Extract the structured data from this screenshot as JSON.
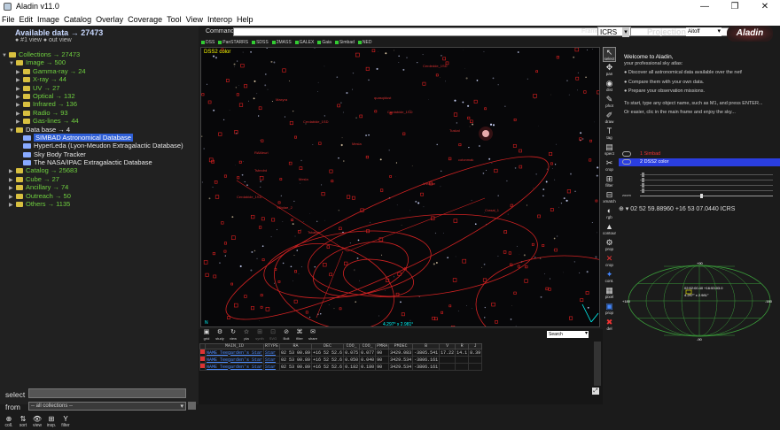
{
  "window": {
    "title": "Aladin v11.0",
    "min": "—",
    "max": "❐",
    "close": "✕"
  },
  "menu": [
    "File",
    "Edit",
    "Image",
    "Catalog",
    "Overlay",
    "Coverage",
    "Tool",
    "View",
    "Interop",
    "Help"
  ],
  "left": {
    "available": "Available data → 27473",
    "view_line": "● #1 view ● out view",
    "tree": [
      {
        "indent": 0,
        "arrow": "▼",
        "type": "folder",
        "label": "Collections → 27473",
        "cls": "green"
      },
      {
        "indent": 1,
        "arrow": "▼",
        "type": "folder",
        "label": "Image → 500",
        "cls": "green"
      },
      {
        "indent": 2,
        "arrow": "▶",
        "type": "folder",
        "label": "Gamma-ray → 24",
        "cls": "green"
      },
      {
        "indent": 2,
        "arrow": "▶",
        "type": "folder",
        "label": "X-ray → 44",
        "cls": "green"
      },
      {
        "indent": 2,
        "arrow": "▶",
        "type": "folder",
        "label": "UV → 27",
        "cls": "green"
      },
      {
        "indent": 2,
        "arrow": "▶",
        "type": "folder",
        "label": "Optical → 132",
        "cls": "green"
      },
      {
        "indent": 2,
        "arrow": "▶",
        "type": "folder",
        "label": "Infrared → 136",
        "cls": "green"
      },
      {
        "indent": 2,
        "arrow": "▶",
        "type": "folder",
        "label": "Radio → 93",
        "cls": "green"
      },
      {
        "indent": 2,
        "arrow": "▶",
        "type": "folder",
        "label": "Gas-lines → 44",
        "cls": "green"
      },
      {
        "indent": 1,
        "arrow": "▼",
        "type": "folder",
        "label": "Data base → 4",
        "cls": "white"
      },
      {
        "indent": 2,
        "arrow": "",
        "type": "item",
        "label": "SIMBAD Astronomical Database",
        "cls": "sel"
      },
      {
        "indent": 2,
        "arrow": "",
        "type": "item",
        "label": "HyperLeda (Lyon-Meudon Extragalactic Database)",
        "cls": "white"
      },
      {
        "indent": 2,
        "arrow": "",
        "type": "item",
        "label": "Sky Body Tracker",
        "cls": "white"
      },
      {
        "indent": 2,
        "arrow": "",
        "type": "item",
        "label": "The NASA/IPAC Extragalactic Database",
        "cls": "white"
      },
      {
        "indent": 1,
        "arrow": "▶",
        "type": "folder",
        "label": "Catalog → 25683",
        "cls": "green"
      },
      {
        "indent": 1,
        "arrow": "▶",
        "type": "folder",
        "label": "Cube → 27",
        "cls": "green"
      },
      {
        "indent": 1,
        "arrow": "▶",
        "type": "folder",
        "label": "Ancillary → 74",
        "cls": "green"
      },
      {
        "indent": 1,
        "arrow": "▶",
        "type": "folder",
        "label": "Outreach → 50",
        "cls": "green"
      },
      {
        "indent": 1,
        "arrow": "▶",
        "type": "folder",
        "label": "Others → 1135",
        "cls": "green"
      }
    ],
    "select_label": "select",
    "from_label": "from",
    "from_value": "-- all collections --",
    "tools": [
      {
        "icon": "⊕",
        "label": "coll."
      },
      {
        "icon": "⇅",
        "label": "sort"
      },
      {
        "icon": "👁",
        "label": "view"
      },
      {
        "icon": "⊞",
        "label": "insp."
      },
      {
        "icon": "Y",
        "label": "filter"
      }
    ]
  },
  "command": {
    "label": "Command",
    "clear": "✕ ▾"
  },
  "frame": {
    "label": "Frame",
    "value": "ICRS"
  },
  "projection": {
    "label": "Projection",
    "value": "Aitoff"
  },
  "logo": "Aladin",
  "surveys": [
    "DSS",
    "PanSTARRS",
    "SDSS",
    "2MASS",
    "GALEX",
    "Gaia",
    "Simbad",
    "NED"
  ],
  "sky": {
    "survey_label": "DSS2 color",
    "coord_text": "4.297° x 2.981°",
    "fov_text": "N",
    "labels": [
      "Cerdedde_1SD",
      "Maxyra",
      "quasqidust",
      "Cerdabide_1SD",
      "Tuskal",
      "Cerdabide_1SD",
      "Tsbndrd",
      "RAMeuri",
      "cotonmak",
      "Mesla",
      "Crasal_1",
      "Cerdabide_1SD",
      "Yllbdae_2",
      "Mesla",
      "Vredrue",
      "Tskalna"
    ]
  },
  "toolbar": [
    {
      "icon": "↖",
      "label": "select",
      "cls": "active"
    },
    {
      "icon": "✥",
      "label": "pan",
      "cls": ""
    },
    {
      "icon": "◉",
      "label": "dist",
      "cls": ""
    },
    {
      "icon": "✎",
      "label": "phot",
      "cls": ""
    },
    {
      "icon": "✐",
      "label": "draw",
      "cls": ""
    },
    {
      "icon": "T",
      "label": "tag",
      "cls": ""
    },
    {
      "icon": "▤",
      "label": "spect",
      "cls": ""
    },
    {
      "icon": "✂",
      "label": "crop",
      "cls": ""
    },
    {
      "icon": "⊞",
      "label": "filter",
      "cls": ""
    },
    {
      "icon": "⊟",
      "label": "xmatch",
      "cls": ""
    },
    {
      "icon": "◐",
      "label": "rgb",
      "cls": ""
    },
    {
      "icon": "▲",
      "label": "contour",
      "cls": ""
    },
    {
      "icon": "⚙",
      "label": "prop",
      "cls": ""
    },
    {
      "icon": "✕",
      "label": "crop",
      "cls": "red"
    },
    {
      "icon": "✦",
      "label": "cont.",
      "cls": "blue"
    },
    {
      "icon": "▦",
      "label": "pixel",
      "cls": ""
    },
    {
      "icon": "▣",
      "label": "prop",
      "cls": "blue"
    },
    {
      "icon": "✖",
      "label": "del",
      "cls": "red"
    }
  ],
  "welcome": {
    "title": "Welcome to Aladin,",
    "subtitle": "your professional sky atlas:",
    "bullets": [
      "Discover all astronomical data available over the net!",
      "Compare them with your own data.",
      "Prepare your observation missions."
    ],
    "hint1": "To start, type any object name, such as M1, and press ENTER...",
    "hint2": "Or easier, clic in the main frame and enjoy the sky..."
  },
  "stack": {
    "layers": [
      {
        "num": "1",
        "name": "Simbad",
        "cls": ""
      },
      {
        "num": "2",
        "name": "DSS2 color",
        "cls": "sel"
      }
    ],
    "zoom_label": "zoom"
  },
  "target_line": "⊕ ▾ 02 52 59.88960 +16 53 07.0440 ICRS",
  "allsky": {
    "center_text": "02:52:00.40 +16:53:03.0",
    "fov": "4.297° x 2.981°",
    "lat_top": "+90",
    "lat_bottom": "-90",
    "lon_left": "+180",
    "lon_right": "-180"
  },
  "table": {
    "tools": [
      {
        "icon": "▣",
        "label": "grid",
        "dim": false
      },
      {
        "icon": "⚙",
        "label": "study",
        "dim": false
      },
      {
        "icon": "↻",
        "label": "view",
        "dim": false
      },
      {
        "icon": "☆",
        "label": "pla",
        "dim": false
      },
      {
        "icon": "⊞",
        "label": "synth",
        "dim": true
      },
      {
        "icon": "⊡",
        "label": "SVG",
        "dim": true
      },
      {
        "icon": "⊘",
        "label": "Bolt",
        "dim": false
      },
      {
        "icon": "⌘",
        "label": "filter",
        "dim": false
      },
      {
        "icon": "✉",
        "label": "share",
        "dim": false
      }
    ],
    "search": "Search",
    "columns": [
      "",
      "MAIN_ID",
      "RTYPE",
      "RA",
      "DEC",
      "COO_",
      "COO_",
      "PMRA",
      "PMDEC",
      "B",
      "V",
      "R",
      "J"
    ],
    "rows": [
      [
        "",
        "NAME Teegarden's Star",
        "Star",
        "02 53 00.89",
        "+16 52 52.6",
        "0.075",
        "0.077",
        "90",
        "3429.083",
        "-3805.541",
        "17.22",
        "14.1",
        "8.39"
      ],
      [
        "",
        "NAME Teegarden's Star",
        "Star",
        "02 53 00.89",
        "+16 52 52.6",
        "0.050",
        "0.040",
        "90",
        "3429.534",
        "-3806.161",
        "",
        "",
        ""
      ],
      [
        "",
        "NAME Teegarden's Star",
        "Star",
        "02 53 00.89",
        "+16 52 52.6",
        "0.182",
        "0.180",
        "90",
        "3429.534",
        "-3806.161",
        "",
        "",
        ""
      ]
    ]
  }
}
